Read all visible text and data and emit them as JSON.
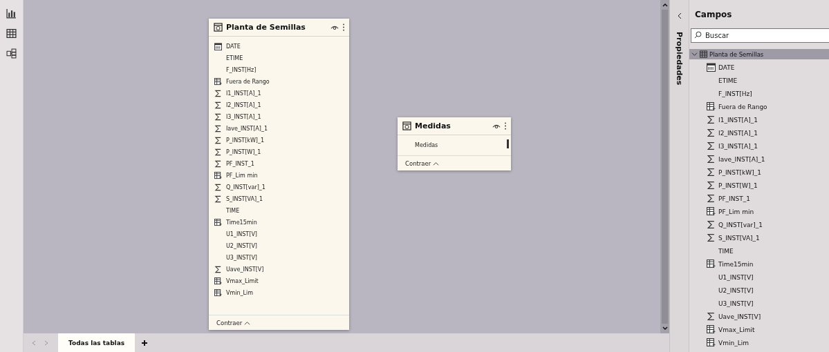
{
  "left_rail": {
    "items": [
      {
        "kind": "report"
      },
      {
        "kind": "data"
      },
      {
        "kind": "model"
      }
    ]
  },
  "diagram": {
    "tables": [
      {
        "name": "Planta de Semillas",
        "collapse_label": "Contraer",
        "has_scrollbar": false,
        "fields": [
          {
            "name": "DATE",
            "kind": "date"
          },
          {
            "name": "ETIME",
            "kind": "plain"
          },
          {
            "name": "F_INST[Hz]",
            "kind": "plain"
          },
          {
            "name": "Fuera de Rango",
            "kind": "calc"
          },
          {
            "name": "I1_INST[A]_1",
            "kind": "sum"
          },
          {
            "name": "I2_INST[A]_1",
            "kind": "sum"
          },
          {
            "name": "I3_INST[A]_1",
            "kind": "sum"
          },
          {
            "name": "Iave_INST[A]_1",
            "kind": "sum"
          },
          {
            "name": "P_INST[kW]_1",
            "kind": "sum"
          },
          {
            "name": "P_INST[W]_1",
            "kind": "sum"
          },
          {
            "name": "PF_INST_1",
            "kind": "sum"
          },
          {
            "name": "PF_Lim min",
            "kind": "calc"
          },
          {
            "name": "Q_INST[var]_1",
            "kind": "sum"
          },
          {
            "name": "S_INST[VA]_1",
            "kind": "sum"
          },
          {
            "name": "TIME",
            "kind": "plain"
          },
          {
            "name": "Time15min",
            "kind": "calc"
          },
          {
            "name": "U1_INST[V]",
            "kind": "plain"
          },
          {
            "name": "U2_INST[V]",
            "kind": "plain"
          },
          {
            "name": "U3_INST[V]",
            "kind": "plain"
          },
          {
            "name": "Uave_INST[V]",
            "kind": "sum"
          },
          {
            "name": "Vmax_Limit",
            "kind": "calc"
          },
          {
            "name": "Vmin_Lim",
            "kind": "calc"
          }
        ]
      },
      {
        "name": "Medidas",
        "collapse_label": "Contraer",
        "has_scrollbar": true,
        "fields": [
          {
            "name": "Medidas",
            "kind": "plain"
          }
        ]
      }
    ]
  },
  "page_tabs": [
    {
      "label": "Todas las tablas",
      "selected": true
    }
  ],
  "properties_pane": {
    "label": "Propiedades"
  },
  "fields_pane": {
    "title": "Campos",
    "search": {
      "placeholder": "Buscar"
    },
    "tree": [
      {
        "name": "Planta de Semillas",
        "expanded": true,
        "selected": true,
        "children": [
          {
            "name": "DATE",
            "kind": "date"
          },
          {
            "name": "ETIME",
            "kind": "plain"
          },
          {
            "name": "F_INST[Hz]",
            "kind": "plain"
          },
          {
            "name": "Fuera de Rango",
            "kind": "calc"
          },
          {
            "name": "I1_INST[A]_1",
            "kind": "sum"
          },
          {
            "name": "I2_INST[A]_1",
            "kind": "sum"
          },
          {
            "name": "I3_INST[A]_1",
            "kind": "sum"
          },
          {
            "name": "Iave_INST[A]_1",
            "kind": "sum"
          },
          {
            "name": "P_INST[kW]_1",
            "kind": "sum"
          },
          {
            "name": "P_INST[W]_1",
            "kind": "sum"
          },
          {
            "name": "PF_INST_1",
            "kind": "sum"
          },
          {
            "name": "PF_Lim min",
            "kind": "calc"
          },
          {
            "name": "Q_INST[var]_1",
            "kind": "sum"
          },
          {
            "name": "S_INST[VA]_1",
            "kind": "sum"
          },
          {
            "name": "TIME",
            "kind": "plain"
          },
          {
            "name": "Time15min",
            "kind": "calc"
          },
          {
            "name": "U1_INST[V]",
            "kind": "plain"
          },
          {
            "name": "U2_INST[V]",
            "kind": "plain"
          },
          {
            "name": "U3_INST[V]",
            "kind": "plain"
          },
          {
            "name": "Uave_INST[V]",
            "kind": "sum"
          },
          {
            "name": "Vmax_Limit",
            "kind": "calc"
          },
          {
            "name": "Vmin_Lim",
            "kind": "calc"
          }
        ]
      }
    ]
  }
}
